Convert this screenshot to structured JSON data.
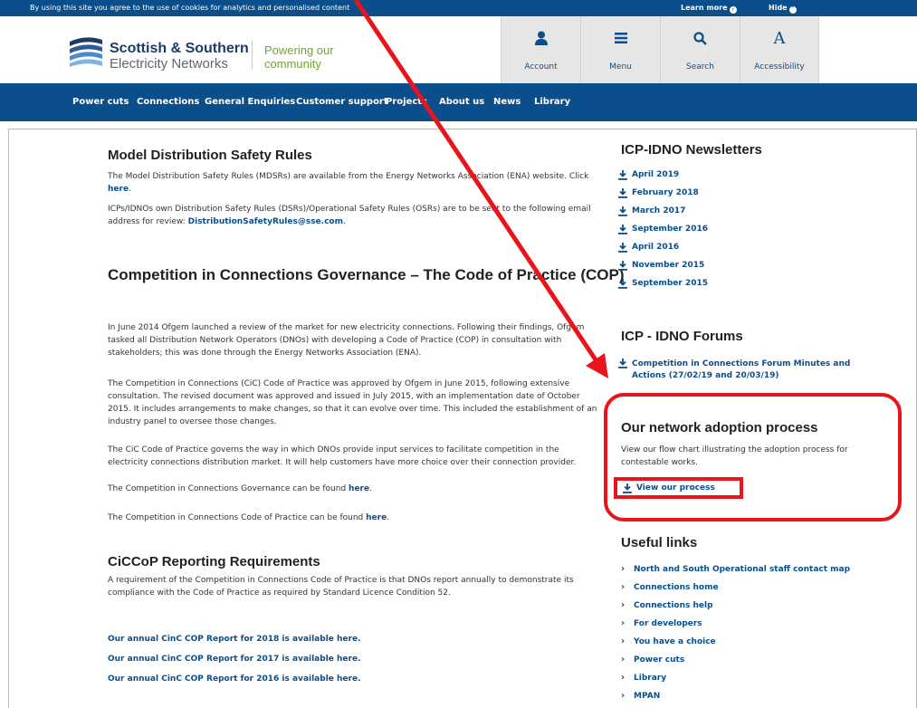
{
  "cookie_bar": {
    "text": "By using this site you agree to the use of cookies for analytics and personalised content",
    "learn_more": "Learn more",
    "hide": "Hide"
  },
  "header": {
    "brand_line1": "Scottish & Southern",
    "brand_line2": "Electricity Networks",
    "tagline_line1": "Powering our",
    "tagline_line2": "community",
    "utility": [
      {
        "label": "Account",
        "icon": "person-icon"
      },
      {
        "label": "Menu",
        "icon": "menu-icon"
      },
      {
        "label": "Search",
        "icon": "search-icon"
      },
      {
        "label": "Accessibility",
        "icon": "accessibility-icon"
      }
    ]
  },
  "nav": {
    "items": [
      "Power cuts",
      "Connections",
      "General Enquiries",
      "Customer support",
      "Projects",
      "About us",
      "News",
      "Library"
    ]
  },
  "main": {
    "mdsr": {
      "title": "Model Distribution Safety Rules",
      "p1_a": "The Model Distribution Safety Rules (MDSRs) are available from the Energy Networks Association (ENA) website. Click",
      "p1_link": "here",
      "p2_a": "ICPs/IDNOs own Distribution Safety Rules (DSRs)/Operational Safety Rules (OSRs) are to be sent to the following email address for review:",
      "p2_link": "DistributionSafetyRules@sse.com"
    },
    "cic": {
      "title": "Competition in Connections Governance – The Code of Practice (COP)",
      "p1": "In June 2014 Ofgem launched a review of the market for new electricity connections. Following their findings, Ofgem tasked all Distribution Network Operators (DNOs) with developing a Code of Practice (COP) in consultation with stakeholders; this was done through the Energy Networks Association (ENA).",
      "p2": "The Competition in Connections (CiC) Code of Practice was approved by Ofgem in June 2015, following extensive consultation. The revised document was approved and issued in July 2015, with an implementation date of October 2015. It includes arrangements to make changes, so that it can evolve over time. This included the establishment of an industry panel to oversee those changes.",
      "p3": "The CiC Code of Practice governs the way in which DNOs provide input services to facilitate competition in the electricity connections distribution market. It will help customers have more choice over their connection provider.",
      "p4_a": "The Competition in Connections Governance can be found",
      "p4_link": "here",
      "p5_a": "The Competition in Connections Code of Practice can be found",
      "p5_link": "here"
    },
    "reporting": {
      "title": "CiCCoP Reporting Requirements",
      "p1": "A requirement of the Competition in Connections Code of Practice is that DNOs report annually to demonstrate its compliance with the Code of Practice as required by Standard Licence Condition 52.",
      "links": [
        "Our annual CinC COP Report for 2018 is available here.",
        "Our annual CinC COP Report for 2017 is available here.",
        "Our annual CinC COP Report for 2016 is available here."
      ]
    }
  },
  "sidebar": {
    "newsletters_title": "ICP-IDNO Newsletters",
    "newsletters": [
      "April 2019",
      "February 2018",
      "March 2017",
      "September 2016",
      "April 2016",
      "November 2015",
      "September 2015"
    ],
    "forums_title": "ICP - IDNO Forums",
    "forum_link_line1": "Competition in Connections Forum Minutes and",
    "forum_link_line2": "Actions (27/02/19 and 20/03/19)",
    "adoption_title": "Our network adoption process",
    "adoption_text": "View our flow chart illustrating the adoption process for contestable works.",
    "adoption_link": "View our process",
    "useful_title": "Useful links",
    "useful_links": [
      "North and South Operational staff contact map",
      "Connections home",
      "Connections help",
      "For developers",
      "You have a choice",
      "Power cuts",
      "Library",
      "MPAN"
    ]
  },
  "colors": {
    "brand_blue": "#0a4e8c",
    "accent_green": "#6fa52e",
    "annotation_red": "#e8151c"
  }
}
